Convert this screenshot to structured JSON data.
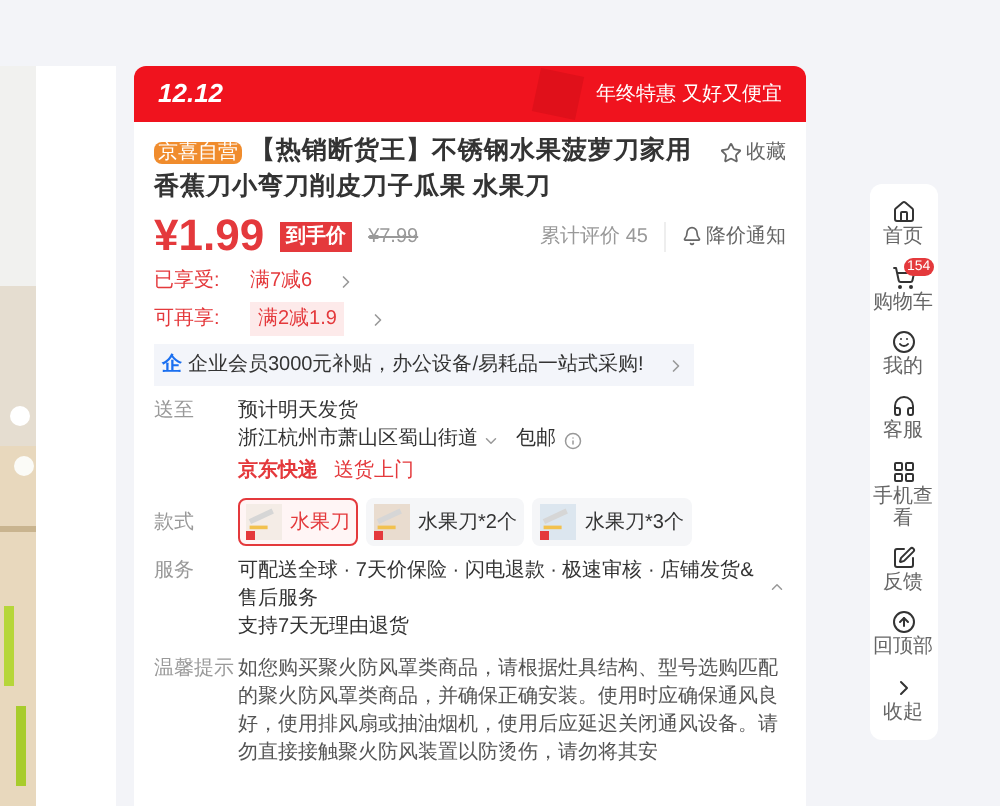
{
  "promo_header": {
    "logo": "12.12",
    "slogan": "年终特惠 又好又便宜"
  },
  "product": {
    "badge": "京喜自营",
    "title": "【热销断货王】不锈钢水果菠萝刀家用香蕉刀小弯刀削皮刀子瓜果 水果刀",
    "favorite": "收藏",
    "price": "¥1.99",
    "price_tag": "到手价",
    "original_price": "¥7.99",
    "review_count": "累计评价 45",
    "price_alert": "降价通知"
  },
  "discounts": [
    {
      "label": "已享受:",
      "value": "满7减6",
      "highlighted": false
    },
    {
      "label": "可再享:",
      "value": "满2减1.9",
      "highlighted": true
    }
  ],
  "enterprise_banner": {
    "icon_text": "企",
    "text": "企业会员3000元补贴，办公设备/易耗品一站式采购!"
  },
  "delivery": {
    "label": "送至",
    "estimate": "预计明天发货",
    "address": "浙江杭州市萧山区蜀山街道",
    "shipping": "包邮",
    "carrier": "京东快递",
    "carrier_note": "送货上门"
  },
  "styles": {
    "label": "款式",
    "options": [
      {
        "name": "水果刀",
        "selected": true
      },
      {
        "name": "水果刀*2个",
        "selected": false
      },
      {
        "name": "水果刀*3个",
        "selected": false
      }
    ]
  },
  "service": {
    "label": "服务",
    "items": "可配送全球 · 7天价保险 · 闪电退款 · 极速审核 · 店铺发货&售后服务",
    "note": "支持7天无理由退货"
  },
  "notice": {
    "label": "温馨提示",
    "text": "如您购买聚火防风罩类商品，请根据灶具结构、型号选购匹配的聚火防风罩类商品，并确保正确安装。使用时应确保通风良好，使用排风扇或抽油烟机，使用后应延迟关闭通风设备。请勿直接接触聚火防风装置以防烫伤，请勿将其安"
  },
  "sidebar": [
    {
      "kind": "home",
      "label": "首页"
    },
    {
      "kind": "cart",
      "label": "购物车",
      "badge": "154"
    },
    {
      "kind": "me",
      "label": "我的"
    },
    {
      "kind": "service",
      "label": "客服"
    },
    {
      "kind": "qr",
      "label": "手机查看"
    },
    {
      "kind": "feedback",
      "label": "反馈"
    },
    {
      "kind": "top",
      "label": "回顶部"
    },
    {
      "kind": "collapse",
      "label": "收起"
    }
  ]
}
